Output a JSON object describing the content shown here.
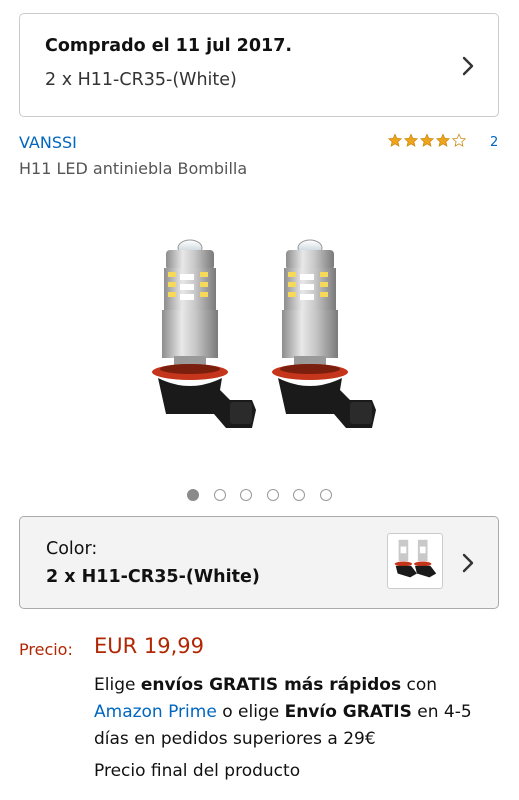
{
  "order": {
    "title": "Comprado el 11 jul 2017.",
    "variant": "2 x H11-CR35-(White)"
  },
  "product": {
    "brand": "VANSSI",
    "rating_stars": 4,
    "rating_count": "2",
    "title": "H11 LED antiniebla Bombilla"
  },
  "carousel": {
    "total_images": 6,
    "active_index": 0
  },
  "color_selector": {
    "label": "Color:",
    "value": "2 x H11-CR35-(White)"
  },
  "price": {
    "label": "Precio:",
    "value": "EUR 19,99"
  },
  "shipping": {
    "part1": "Elige ",
    "bold1": "envíos GRATIS más rápidos",
    "part2": " con ",
    "prime_link": "Amazon Prime",
    "part3": " o elige ",
    "bold2": "Envío GRATIS",
    "part4": " en 4-5 días en pedidos superiores a 29€"
  },
  "final_price_text": "Precio final del producto",
  "colors": {
    "link": "#0066c0",
    "price": "#b12704",
    "star": "#f0a41c"
  },
  "icons": {
    "chevron": "chevron-right-icon",
    "star": "star-icon"
  }
}
